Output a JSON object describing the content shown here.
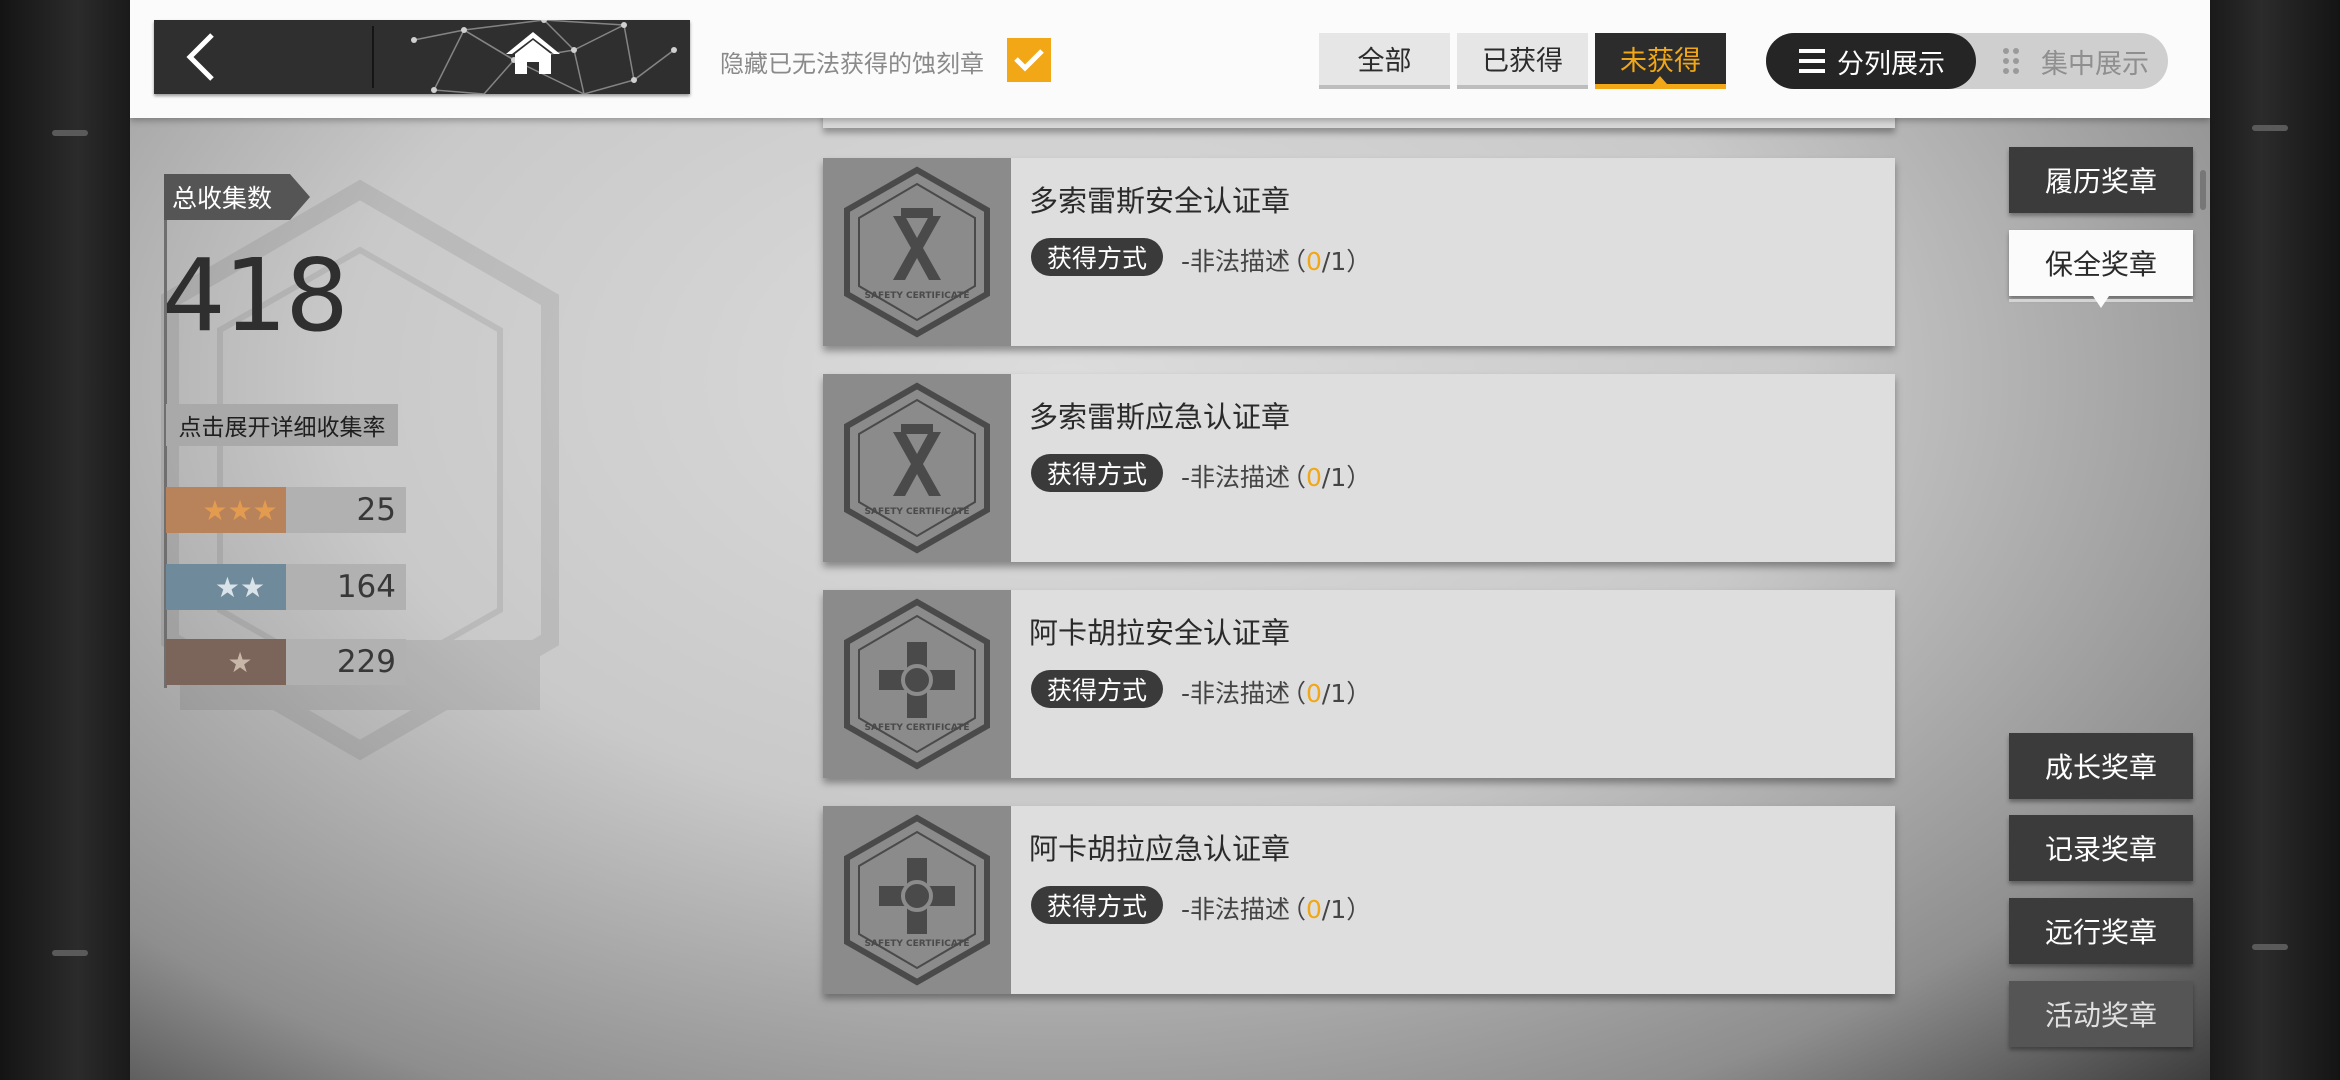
{
  "topbar": {
    "hide_unobtainable_label": "隐藏已无法获得的蚀刻章",
    "hide_unobtainable_checked": true,
    "filters": [
      {
        "label": "全部",
        "active": false
      },
      {
        "label": "已获得",
        "active": false
      },
      {
        "label": "未获得",
        "active": true
      }
    ],
    "view_split_label": "分列展示",
    "view_focus_label": "集中展示"
  },
  "stats": {
    "total_label": "总收集数",
    "total_value": "418",
    "expand_label": "点击展开详细收集率",
    "rows": [
      {
        "stars": "★★★",
        "count": "25",
        "color": "#e39c4f"
      },
      {
        "stars": "★★",
        "count": "164",
        "color": "#6f8a9a"
      },
      {
        "stars": "★",
        "count": "229",
        "color": "#7b6459"
      }
    ]
  },
  "medals": [
    {
      "name": "多索雷斯安全认证章",
      "method_label": "获得方式",
      "desc": "-非法描述",
      "count_open": "（",
      "count_have": "0",
      "count_total": "/1）",
      "emblem": "x-chevron"
    },
    {
      "name": "多索雷斯应急认证章",
      "method_label": "获得方式",
      "desc": "-非法描述",
      "count_open": "（",
      "count_have": "0",
      "count_total": "/1）",
      "emblem": "x-chevron"
    },
    {
      "name": "阿卡胡拉安全认证章",
      "method_label": "获得方式",
      "desc": "-非法描述",
      "count_open": "（",
      "count_have": "0",
      "count_total": "/1）",
      "emblem": "cross-knot"
    },
    {
      "name": "阿卡胡拉应急认证章",
      "method_label": "获得方式",
      "desc": "-非法描述",
      "count_open": "（",
      "count_have": "0",
      "count_total": "/1）",
      "emblem": "cross-knot"
    }
  ],
  "emblem_text": "SAFETY CERTIFICATE",
  "categories": [
    {
      "label": "履历奖章",
      "active": false
    },
    {
      "label": "保全奖章",
      "active": true
    },
    {
      "label": "成长奖章",
      "active": false
    },
    {
      "label": "记录奖章",
      "active": false
    },
    {
      "label": "远行奖章",
      "active": false
    },
    {
      "label": "活动奖章",
      "active": false
    }
  ],
  "colors": {
    "accent": "#f1a716",
    "dark": "#2c2c2c"
  }
}
